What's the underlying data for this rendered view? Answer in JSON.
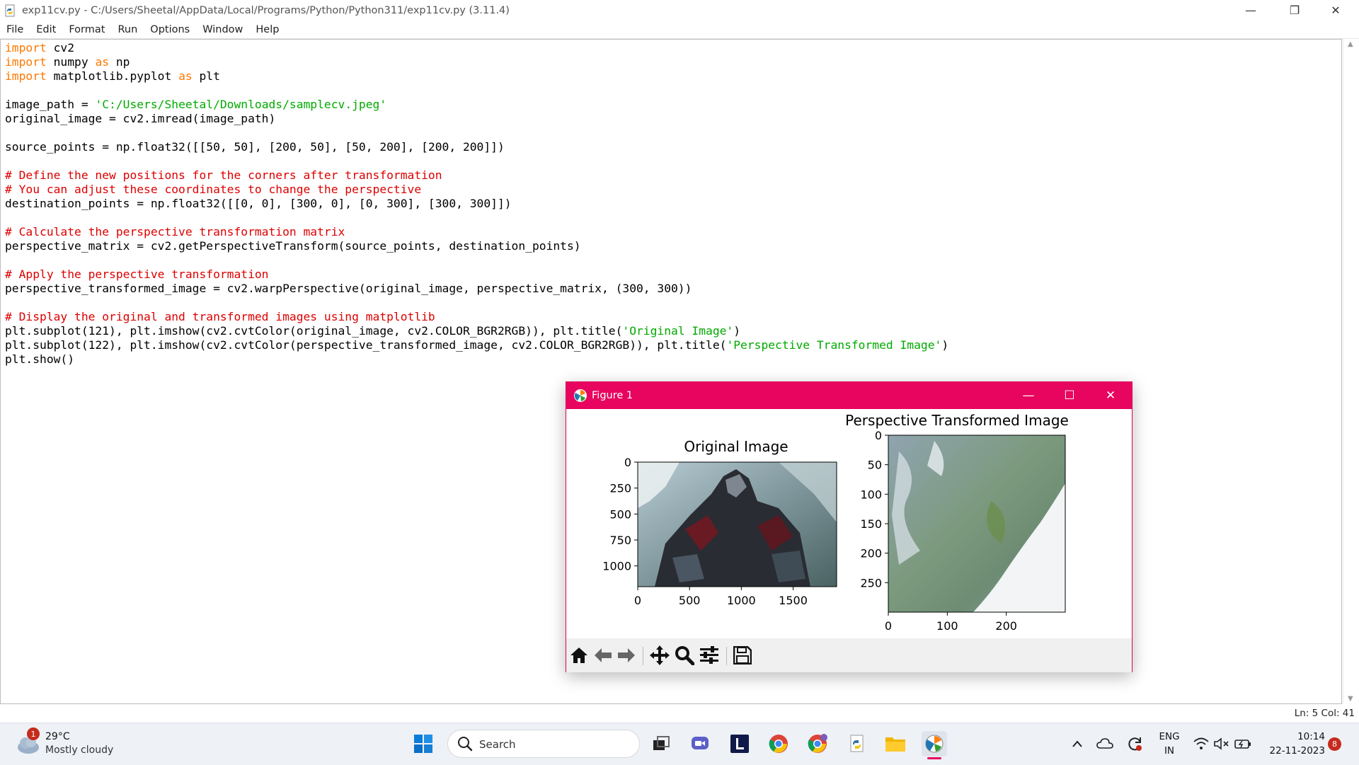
{
  "window": {
    "title": "exp11cv.py - C:/Users/Sheetal/AppData/Local/Programs/Python/Python311/exp11cv.py (3.11.4)",
    "minimize_glyph": "—",
    "restore_glyph": "❐",
    "close_glyph": "✕"
  },
  "menu": [
    "File",
    "Edit",
    "Format",
    "Run",
    "Options",
    "Window",
    "Help"
  ],
  "code_lines": [
    [
      {
        "t": "import",
        "c": "kw"
      },
      {
        "t": " cv2"
      }
    ],
    [
      {
        "t": "import",
        "c": "kw"
      },
      {
        "t": " numpy "
      },
      {
        "t": "as",
        "c": "kw"
      },
      {
        "t": " np"
      }
    ],
    [
      {
        "t": "import",
        "c": "kw"
      },
      {
        "t": " matplotlib.pyplot "
      },
      {
        "t": "as",
        "c": "kw"
      },
      {
        "t": " plt"
      }
    ],
    [],
    [
      {
        "t": "image_path = "
      },
      {
        "t": "'C:/Users/Sheetal/Downloads/samplecv.jpeg'",
        "c": "str"
      }
    ],
    [
      {
        "t": "original_image = cv2.imread(image_path)"
      }
    ],
    [],
    [
      {
        "t": "source_points = np.float32([[50, 50], [200, 50], [50, 200], [200, 200]])"
      }
    ],
    [],
    [
      {
        "t": "# Define the new positions for the corners after transformation",
        "c": "cm"
      }
    ],
    [
      {
        "t": "# You can adjust these coordinates to change the perspective",
        "c": "cm"
      }
    ],
    [
      {
        "t": "destination_points = np.float32([[0, 0], [300, 0], [0, 300], [300, 300]])"
      }
    ],
    [],
    [
      {
        "t": "# Calculate the perspective transformation matrix",
        "c": "cm"
      }
    ],
    [
      {
        "t": "perspective_matrix = cv2.getPerspectiveTransform(source_points, destination_points)"
      }
    ],
    [],
    [
      {
        "t": "# Apply the perspective transformation",
        "c": "cm"
      }
    ],
    [
      {
        "t": "perspective_transformed_image = cv2.warpPerspective(original_image, perspective_matrix, (300, 300))"
      }
    ],
    [],
    [
      {
        "t": "# Display the original and transformed images using matplotlib",
        "c": "cm"
      }
    ],
    [
      {
        "t": "plt.subplot(121), plt.imshow(cv2.cvtColor(original_image, cv2.COLOR_BGR2RGB)), plt.title("
      },
      {
        "t": "'Original Image'",
        "c": "str"
      },
      {
        "t": ")"
      }
    ],
    [
      {
        "t": "plt.subplot(122), plt.imshow(cv2.cvtColor(perspective_transformed_image, cv2.COLOR_BGR2RGB)), plt.title("
      },
      {
        "t": "'Perspective Transformed Image'",
        "c": "str"
      },
      {
        "t": ")"
      }
    ],
    [
      {
        "t": "plt.show()"
      }
    ]
  ],
  "status": {
    "position": "Ln: 5   Col: 41"
  },
  "figure": {
    "title": "Figure 1",
    "accent": "#e8055f",
    "minimize_glyph": "—",
    "maximize_glyph": "☐",
    "close_glyph": "✕",
    "plots": [
      {
        "title": "Original Image",
        "y_ticks": [
          "0",
          "250",
          "500",
          "750",
          "1000"
        ],
        "y_values": [
          0,
          250,
          500,
          750,
          1000
        ],
        "x_ticks": [
          "0",
          "500",
          "1000",
          "1500"
        ],
        "x_values": [
          0,
          500,
          1000,
          1500
        ],
        "x_range": [
          0,
          1920
        ],
        "y_range": [
          0,
          1200
        ]
      },
      {
        "title": "Perspective Transformed Image",
        "y_ticks": [
          "0",
          "50",
          "100",
          "150",
          "200",
          "250"
        ],
        "y_values": [
          0,
          50,
          100,
          150,
          200,
          250
        ],
        "x_ticks": [
          "0",
          "100",
          "200"
        ],
        "x_values": [
          0,
          100,
          200
        ],
        "x_range": [
          0,
          300
        ],
        "y_range": [
          0,
          300
        ]
      }
    ],
    "toolbar_icons": [
      "home-icon",
      "back-arrow-icon",
      "forward-arrow-icon",
      "pan-icon",
      "zoom-icon",
      "configure-subplots-icon",
      "save-icon"
    ]
  },
  "taskbar": {
    "weather_temp": "29°C",
    "weather_desc": "Mostly cloudy",
    "weather_badge": "1",
    "search_label": "Search",
    "lang_line1": "ENG",
    "lang_line2": "IN",
    "time": "10:14",
    "date": "22-11-2023",
    "notification_count": "8"
  }
}
